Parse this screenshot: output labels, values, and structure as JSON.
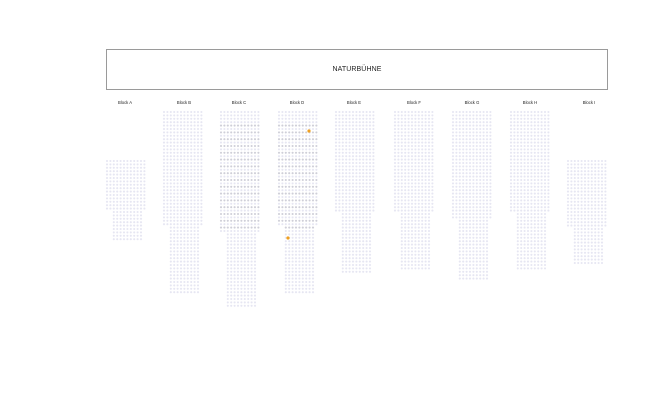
{
  "stage": {
    "label": "NATURBÜHNE"
  },
  "colors": {
    "seat_available": "#e6e6f2",
    "seat_dark": "#cfcfd8",
    "seat_selected": "#f0a020"
  },
  "blocks": [
    {
      "label": "Block A"
    },
    {
      "label": "Block B"
    },
    {
      "label": "Block C"
    },
    {
      "label": "Block D"
    },
    {
      "label": "Block E"
    },
    {
      "label": "Block F"
    },
    {
      "label": "Block G"
    },
    {
      "label": "Block H"
    },
    {
      "label": "Block I"
    }
  ]
}
